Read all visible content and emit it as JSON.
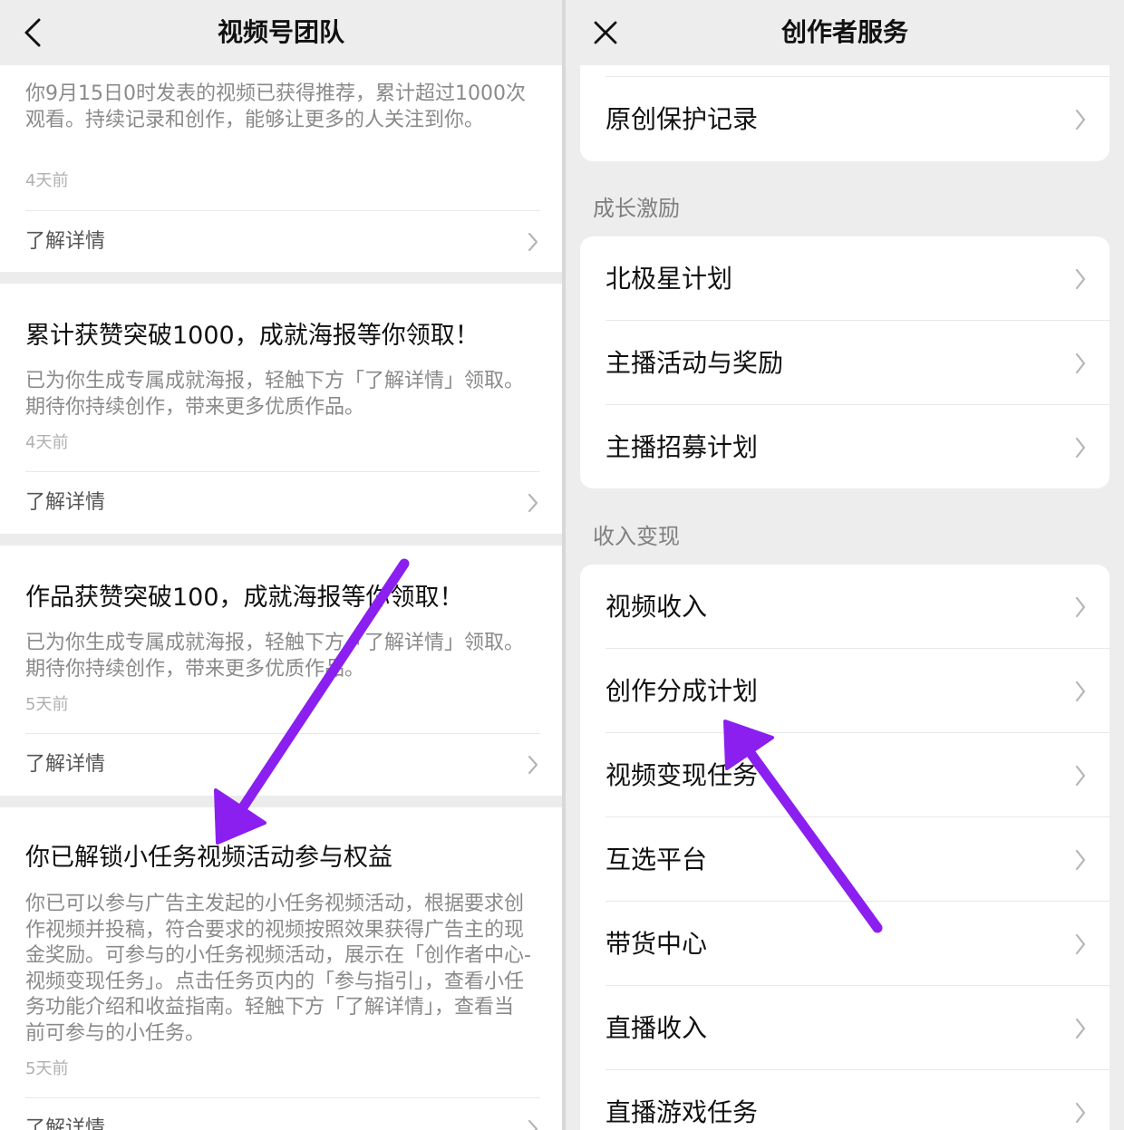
{
  "left_panel": {
    "title": "视频号团队",
    "back_icon": "chevron-left-icon",
    "cards": [
      {
        "title": "",
        "body": "你9月15日0时发表的视频已获得推荐，累计超过1000次观看。持续记录和创作，能够让更多的人关注到你。",
        "time": "4天前",
        "link": "了解详情"
      },
      {
        "title": "累计获赞突破1000，成就海报等你领取！",
        "body": "已为你生成专属成就海报，轻触下方「了解详情」领取。期待你持续创作，带来更多优质作品。",
        "time": "4天前",
        "link": "了解详情"
      },
      {
        "title": "作品获赞突破100，成就海报等你领取！",
        "body": "已为你生成专属成就海报，轻触下方「了解详情」领取。期待你持续创作，带来更多优质作品。",
        "time": "5天前",
        "link": "了解详情"
      },
      {
        "title": "你已解锁小任务视频活动参与权益",
        "body": "你已可以参与广告主发起的小任务视频活动，根据要求创作视频并投稿，符合要求的视频按照效果获得广告主的现金奖励。可参与的小任务视频活动，展示在「创作者中心-视频变现任务」。点击任务页内的「参与指引」，查看小任务功能介绍和收益指南。轻触下方「了解详情」，查看当前可参与的小任务。",
        "time": "5天前",
        "link": "了解详情"
      }
    ]
  },
  "right_panel": {
    "title": "创作者服务",
    "close_icon": "close-icon",
    "top_group": [
      {
        "label": "原创保护记录"
      }
    ],
    "sections": [
      {
        "label": "成长激励",
        "items": [
          {
            "label": "北极星计划"
          },
          {
            "label": "主播活动与奖励"
          },
          {
            "label": "主播招募计划"
          }
        ]
      },
      {
        "label": "收入变现",
        "items": [
          {
            "label": "视频收入"
          },
          {
            "label": "创作分成计划"
          },
          {
            "label": "视频变现任务"
          },
          {
            "label": "互选平台"
          },
          {
            "label": "带货中心"
          },
          {
            "label": "直播收入"
          },
          {
            "label": "直播游戏任务"
          }
        ]
      }
    ]
  },
  "colors": {
    "annotation_arrow": "#8a1ff0",
    "secondary_text": "#8a8a8a",
    "background": "#ededed"
  }
}
